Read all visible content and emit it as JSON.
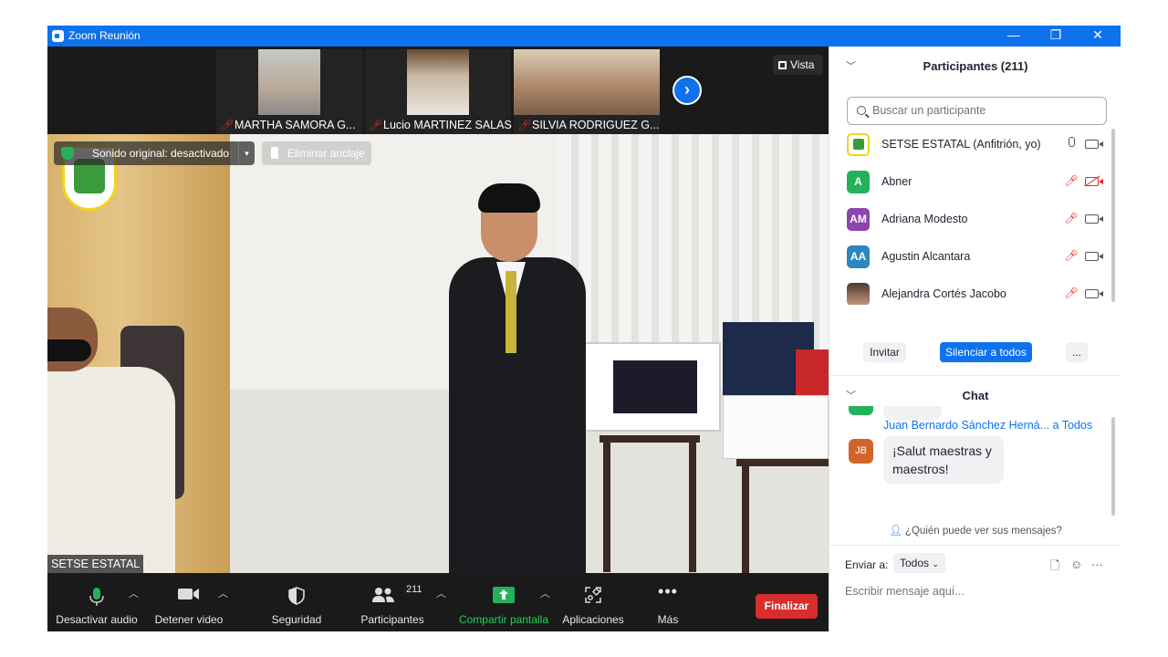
{
  "window": {
    "title": "Zoom Reunión",
    "controls": [
      "—",
      "❐",
      "✕"
    ]
  },
  "gallery": [
    {
      "name": "MARTHA SAMORA G..."
    },
    {
      "name": "Lucio MARTINEZ SALAS"
    },
    {
      "name": "SILVIA RODRIGUEZ G..."
    }
  ],
  "view_button": "Vista",
  "banner": {
    "original_sound": "Sonido original: desactivado",
    "unpin": "Eliminar anclaje"
  },
  "main_speaker_name": "SETSE ESTATAL",
  "toolbar": {
    "mute": "Desactivar audio",
    "video": "Detener video",
    "security": "Seguridad",
    "participants": "Participantes",
    "participants_count": "211",
    "share": "Compartir pantalla",
    "apps": "Aplicaciones",
    "more": "Más",
    "end": "Finalizar"
  },
  "participants_panel": {
    "title": "Participantes (211)",
    "search_placeholder": "Buscar un participante",
    "items": [
      {
        "initials": "",
        "name": "SETSE ESTATAL (Anfitrión, yo)",
        "color": "#ffffff",
        "mic": "on",
        "cam": "on"
      },
      {
        "initials": "A",
        "name": "Abner",
        "color": "#23b15a",
        "mic": "off",
        "cam": "off"
      },
      {
        "initials": "AM",
        "name": "Adriana Modesto",
        "color": "#8e44ad",
        "mic": "off",
        "cam": "on"
      },
      {
        "initials": "AA",
        "name": "Agustin Alcantara",
        "color": "#2e86c1",
        "mic": "off",
        "cam": "on"
      },
      {
        "initials": "",
        "name": "Alejandra Cortés Jacobo",
        "color": "#b8876a",
        "mic": "off",
        "cam": "on"
      }
    ],
    "invite": "Invitar",
    "mute_all": "Silenciar a todos",
    "more": "..."
  },
  "chat_panel": {
    "title": "Chat",
    "message": {
      "sender_initials": "JB",
      "sender": "Juan Bernardo Sánchez Herná...",
      "to": "a Todos",
      "text": "¡Salut maestras y maestros!"
    },
    "who_sees": "¿Quién puede ver sus mensajes?",
    "send_to_label": "Enviar a:",
    "send_to_value": "Todos",
    "input_placeholder": "Escribir mensaje aquí..."
  },
  "colors": {
    "titlebar": "#0e72ed",
    "end_button": "#d92d2d",
    "share_green": "#23b15a",
    "mute_all_button": "#0e72ed"
  }
}
